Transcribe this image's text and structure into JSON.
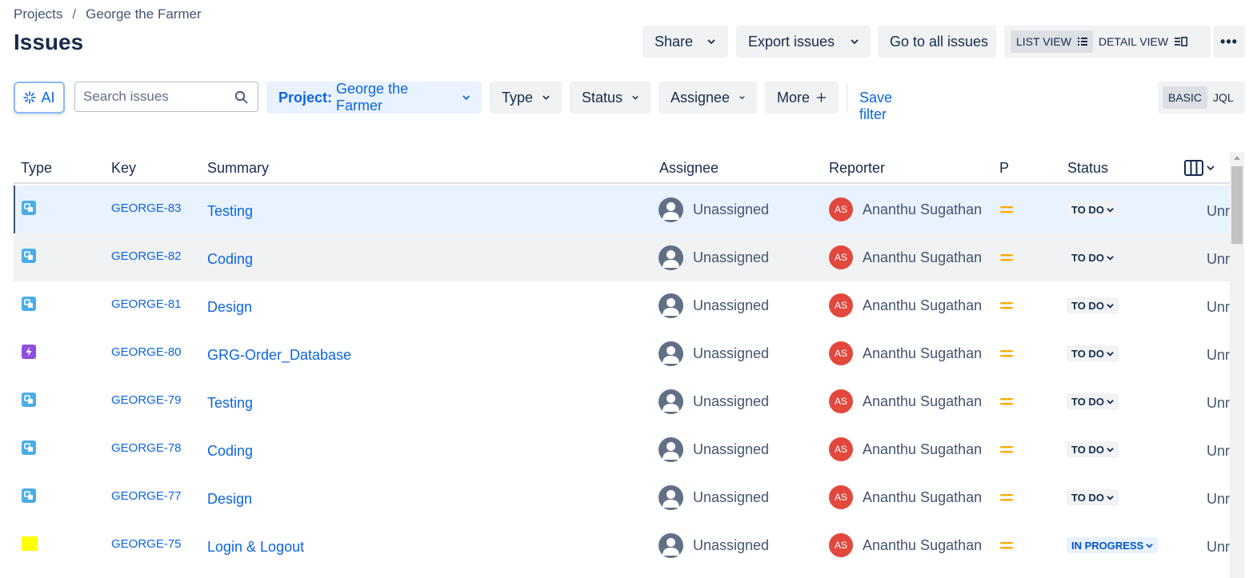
{
  "breadcrumb": {
    "root": "Projects",
    "separator": "/",
    "project": "George the Farmer"
  },
  "page": {
    "title": "Issues"
  },
  "toolbar": {
    "share": "Share",
    "export": "Export issues",
    "goto": "Go to all issues",
    "list_view": "LIST VIEW",
    "detail_view": "DETAIL VIEW",
    "more": "•••"
  },
  "filters": {
    "ai": "AI",
    "search_placeholder": "Search issues",
    "project_label": "Project:",
    "project_value": "George the Farmer",
    "type": "Type",
    "status": "Status",
    "assignee": "Assignee",
    "more": "More",
    "save_filter": "Save filter",
    "basic": "BASIC",
    "jql": "JQL"
  },
  "table": {
    "headers": {
      "type": "Type",
      "key": "Key",
      "summary": "Summary",
      "assignee": "Assignee",
      "reporter": "Reporter",
      "priority": "P",
      "status": "Status"
    },
    "rows": [
      {
        "type_icon": "subtask-icon",
        "key": "GEORGE-83",
        "summary": "Testing",
        "assignee": "Unassigned",
        "reporter_initials": "AS",
        "reporter": "Ananthu Sugathan",
        "status": "TO DO",
        "extra": "Unr"
      },
      {
        "type_icon": "subtask-icon",
        "key": "GEORGE-82",
        "summary": "Coding",
        "assignee": "Unassigned",
        "reporter_initials": "AS",
        "reporter": "Ananthu Sugathan",
        "status": "TO DO",
        "extra": "Unr"
      },
      {
        "type_icon": "subtask-icon",
        "key": "GEORGE-81",
        "summary": "Design",
        "assignee": "Unassigned",
        "reporter_initials": "AS",
        "reporter": "Ananthu Sugathan",
        "status": "TO DO",
        "extra": "Unr"
      },
      {
        "type_icon": "epic-icon",
        "key": "GEORGE-80",
        "summary": "GRG-Order_Database",
        "assignee": "Unassigned",
        "reporter_initials": "AS",
        "reporter": "Ananthu Sugathan",
        "status": "TO DO",
        "extra": "Unr"
      },
      {
        "type_icon": "subtask-icon",
        "key": "GEORGE-79",
        "summary": "Testing",
        "assignee": "Unassigned",
        "reporter_initials": "AS",
        "reporter": "Ananthu Sugathan",
        "status": "TO DO",
        "extra": "Unr"
      },
      {
        "type_icon": "subtask-icon",
        "key": "GEORGE-78",
        "summary": "Coding",
        "assignee": "Unassigned",
        "reporter_initials": "AS",
        "reporter": "Ananthu Sugathan",
        "status": "TO DO",
        "extra": "Unr"
      },
      {
        "type_icon": "subtask-icon",
        "key": "GEORGE-77",
        "summary": "Design",
        "assignee": "Unassigned",
        "reporter_initials": "AS",
        "reporter": "Ananthu Sugathan",
        "status": "TO DO",
        "extra": "Unr"
      },
      {
        "type_icon": "custom-type-icon",
        "key": "GEORGE-75",
        "summary": "Login & Logout",
        "assignee": "Unassigned",
        "reporter_initials": "AS",
        "reporter": "Ananthu Sugathan",
        "status": "IN PROGRESS",
        "extra": "Unr"
      }
    ]
  },
  "colors": {
    "link": "#0c66e4",
    "priority_medium": "#ffab00",
    "reporter_avatar": "#e2483d",
    "subtask": "#4bade8",
    "epic": "#904ee2",
    "custom_type": "#ffff00"
  }
}
